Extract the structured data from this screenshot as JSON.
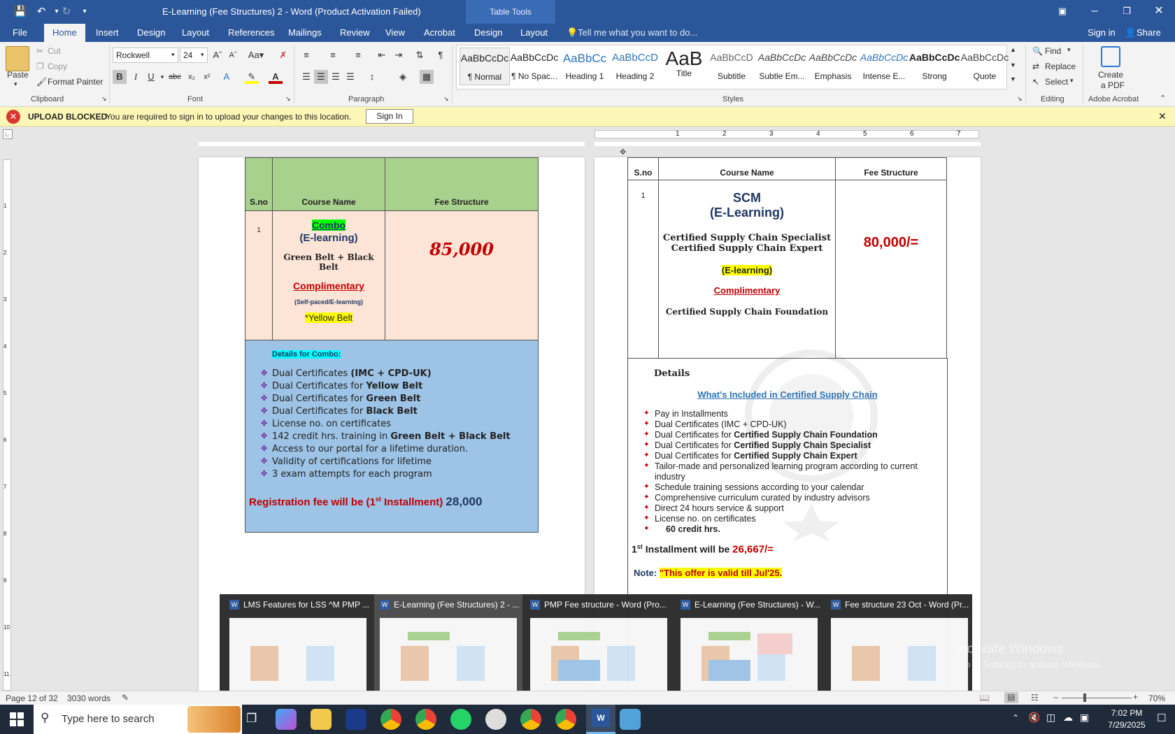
{
  "window": {
    "title": "E-Learning (Fee Structures) 2 - Word (Product Activation Failed)",
    "context_tab": "Table Tools"
  },
  "menu": {
    "tabs": [
      "File",
      "Home",
      "Insert",
      "Design",
      "Layout",
      "References",
      "Mailings",
      "Review",
      "View",
      "Acrobat",
      "Design",
      "Layout"
    ],
    "tell_me": "Tell me what you want to do...",
    "sign_in": "Sign in",
    "share": "Share"
  },
  "ribbon": {
    "clipboard": {
      "paste": "Paste",
      "cut": "Cut",
      "copy": "Copy",
      "format_painter": "Format Painter",
      "label": "Clipboard"
    },
    "font": {
      "name": "Rockwell",
      "size": "24",
      "label": "Font"
    },
    "paragraph": {
      "label": "Paragraph"
    },
    "styles": {
      "label": "Styles",
      "items": [
        {
          "preview": "AaBbCcDc",
          "name": "¶ Normal"
        },
        {
          "preview": "AaBbCcDc",
          "name": "¶ No Spac..."
        },
        {
          "preview": "AaBbCc",
          "name": "Heading 1"
        },
        {
          "preview": "AaBbCcD",
          "name": "Heading 2"
        },
        {
          "preview": "AaB",
          "name": "Title"
        },
        {
          "preview": "AaBbCcD",
          "name": "Subtitle"
        },
        {
          "preview": "AaBbCcDc",
          "name": "Subtle Em..."
        },
        {
          "preview": "AaBbCcDc",
          "name": "Emphasis"
        },
        {
          "preview": "AaBbCcDc",
          "name": "Intense E..."
        },
        {
          "preview": "AaBbCcDc",
          "name": "Strong"
        },
        {
          "preview": "AaBbCcDc",
          "name": "Quote"
        }
      ]
    },
    "editing": {
      "find": "Find",
      "replace": "Replace",
      "select": "Select",
      "label": "Editing"
    },
    "acrobat": {
      "create_pdf_1": "Create",
      "create_pdf_2": "a PDF",
      "label": "Adobe Acrobat"
    }
  },
  "message_bar": {
    "title": "UPLOAD BLOCKED",
    "text": "You are required to sign in to upload your changes to this location.",
    "button": "Sign In"
  },
  "left_page": {
    "headers": [
      "S.no",
      "Course Name",
      "Fee Structure"
    ],
    "sno": "1",
    "combo": "Combo",
    "elearning": "(E-learning)",
    "belts": "Green Belt + Black Belt",
    "complimentary": "Complimentary",
    "selfpaced": "(Self-paced/E-learning)",
    "yellow": "*Yellow Belt",
    "fee": "85,000",
    "details_title": "Details for Combo:",
    "details": [
      {
        "pre": "Dual Certificates ",
        "bold": "(IMC + CPD-UK)"
      },
      {
        "pre": "Dual Certificates for ",
        "bold": "Yellow Belt"
      },
      {
        "pre": "Dual Certificates for ",
        "bold": "Green Belt"
      },
      {
        "pre": "Dual Certificates for ",
        "bold": "Black Belt"
      },
      {
        "pre": "License no. on certificates",
        "bold": ""
      },
      {
        "pre": "142 credit hrs. training in ",
        "bold": "Green Belt + Black Belt"
      },
      {
        "pre": "Access to our portal for a lifetime duration.",
        "bold": ""
      },
      {
        "pre": "Validity of certifications for lifetime",
        "bold": ""
      },
      {
        "pre": "3 exam attempts for each program",
        "bold": ""
      }
    ],
    "reg_pre": "Registration fee will be (1",
    "reg_sup": "st",
    "reg_post": " Installment)",
    "reg_amount": "28,000"
  },
  "right_page": {
    "headers": [
      "S.no",
      "Course Name",
      "Fee Structure"
    ],
    "sno": "1",
    "scm": "SCM",
    "elearning_big": "(E-Learning)",
    "cert1": "Certified Supply Chain Specialist",
    "cert2": "Certified Supply Chain Expert",
    "elearning_hl": "(E-learning)",
    "complimentary": "Complimentary",
    "foundation": "Certified Supply Chain Foundation",
    "fee": "80,000/=",
    "details_title": "Details",
    "included_link": "What's Included in Certified Supply Chain",
    "details": [
      {
        "pre": "Pay in Installments",
        "bold": ""
      },
      {
        "pre": "Dual Certificates (IMC + CPD-UK)",
        "bold": ""
      },
      {
        "pre": "Dual Certificates for ",
        "bold": "Certified Supply Chain Foundation"
      },
      {
        "pre": "Dual Certificates for ",
        "bold": "Certified Supply Chain Specialist"
      },
      {
        "pre": "Dual Certificates for ",
        "bold": "Certified Supply Chain Expert"
      },
      {
        "pre": "Tailor-made and personalized learning program according to current",
        "bold": ""
      },
      {
        "pre": "industry",
        "bold": ""
      },
      {
        "pre": "Schedule training sessions according to your calendar",
        "bold": ""
      },
      {
        "pre": "Comprehensive curriculum curated by industry advisors",
        "bold": ""
      },
      {
        "pre": "Direct 24 hours service & support",
        "bold": ""
      },
      {
        "pre": "License no. on certificates",
        "bold": ""
      },
      {
        "pre": "",
        "bold": "60 credit hrs."
      }
    ],
    "inst_num": "1",
    "inst_sup": "st",
    "inst_text": " Installment will be ",
    "inst_amount": "26,667/=",
    "note_label": "Note:",
    "note_text": "\"This offer is valid till Jul'25."
  },
  "ruler": {
    "numbers": [
      "1",
      "2",
      "3",
      "4",
      "5",
      "6",
      "7"
    ]
  },
  "vruler": {
    "numbers": [
      "1",
      "2",
      "3",
      "4",
      "5",
      "6",
      "7",
      "8",
      "9",
      "10",
      "11"
    ]
  },
  "thumbnails": [
    "LMS Features for LSS ^M PMP ...",
    "E-Learning (Fee Structures) 2 - ...",
    "PMP Fee structure - Word (Pro...",
    "E-Learning (Fee Structures) - W...",
    "Fee structure 23 Oct - Word (Pr..."
  ],
  "watermark": {
    "line1": "Activate Windows",
    "line2": "Go to Settings to activate Windows."
  },
  "status": {
    "page": "Page 12 of 32",
    "words": "3030 words",
    "zoom": "70%",
    "zoom_level": 0.7
  },
  "taskbar": {
    "search": "Type here to search",
    "time": "7:02 PM",
    "date": "7/29/2025"
  },
  "colors": {
    "word_blue": "#2b579a",
    "header_green": "#a9d18e",
    "peach": "#fce4d6",
    "details_blue": "#9dc3e6",
    "dark_red": "#c00000",
    "navy": "#1f3864"
  }
}
